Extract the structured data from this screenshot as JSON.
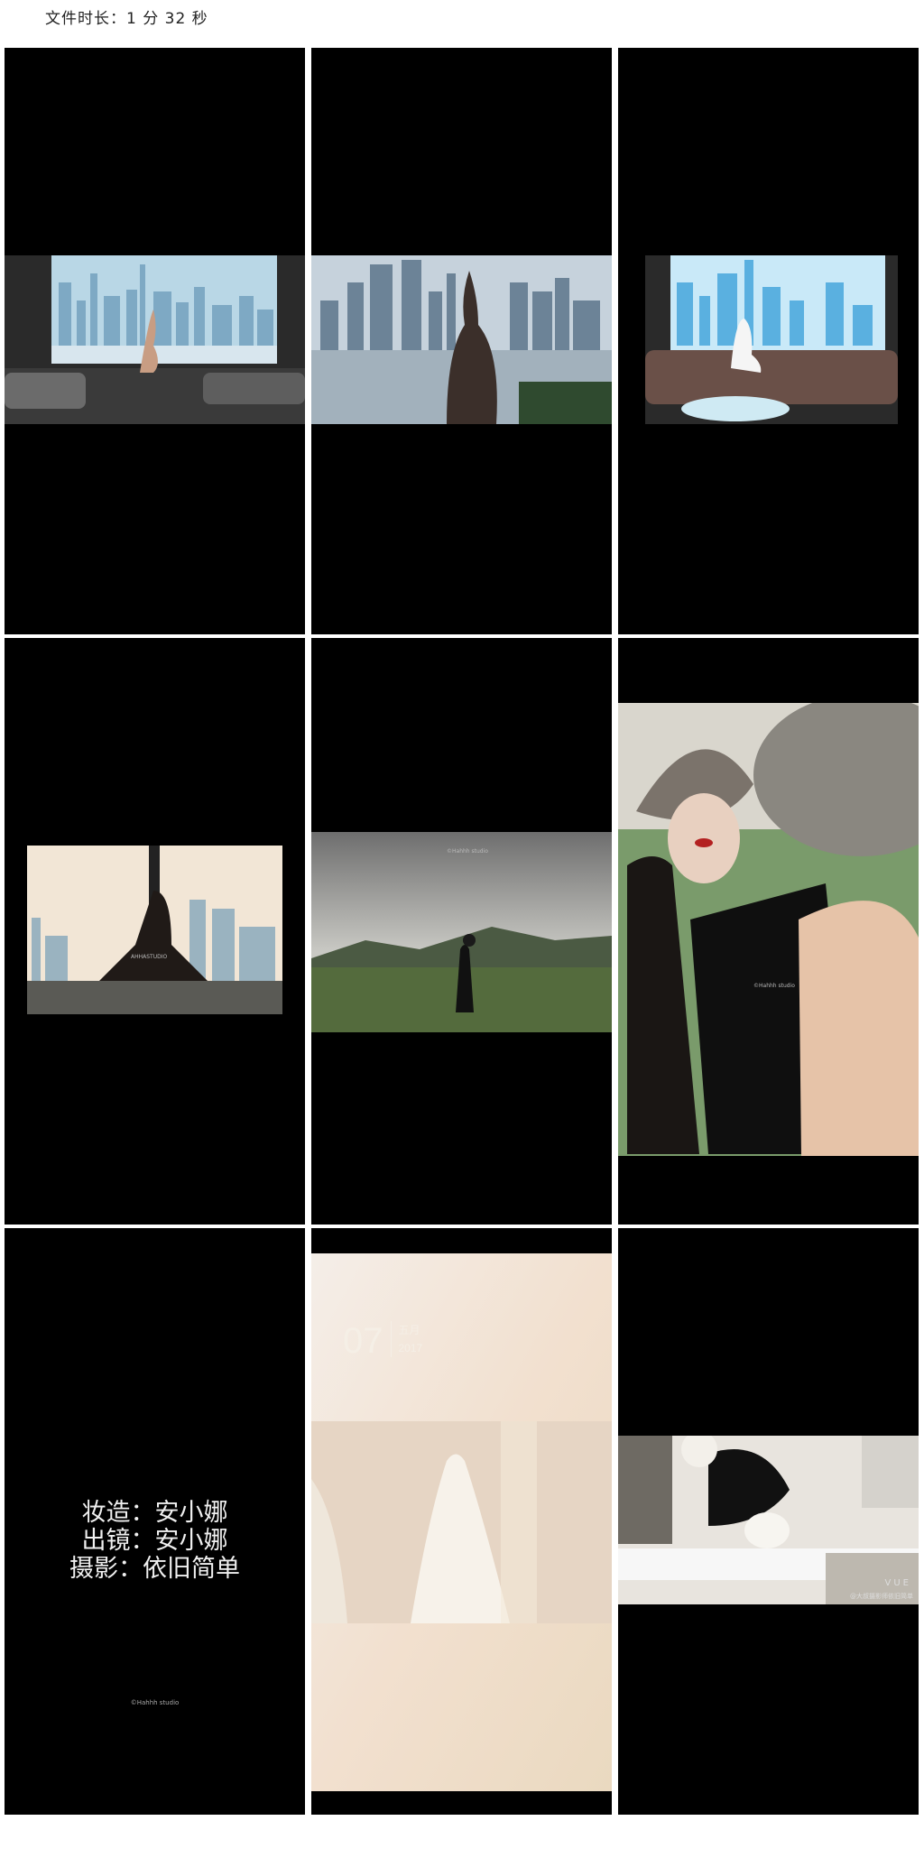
{
  "header": {
    "duration_label": "文件时长：1 分 32 秒"
  },
  "tiles": {
    "t1": {
      "scene": "city-window-silhouette"
    },
    "t2": {
      "scene": "city-window-closeup"
    },
    "t3": {
      "scene": "city-window-sofa"
    },
    "t4": {
      "scene": "window-sitting-pose",
      "watermark": "AHHASTUDIO"
    },
    "t5": {
      "scene": "field-woman-hat",
      "watermark": "©Hahhh studio"
    },
    "t6": {
      "scene": "hat-closeup",
      "watermark": "©Hahhh studio"
    },
    "t7": {
      "credits": [
        "妆造：安小娜",
        "出镜：安小娜",
        "摄影：依旧简单"
      ],
      "watermark": "©Hahhh studio"
    },
    "t8": {
      "scene": "wedding-dress",
      "date_num": "07",
      "month": "五月",
      "year": "2017"
    },
    "t9": {
      "scene": "studio-behind-scenes",
      "brand": "VUE",
      "credit": "@大叔摄影师依旧简单"
    }
  }
}
